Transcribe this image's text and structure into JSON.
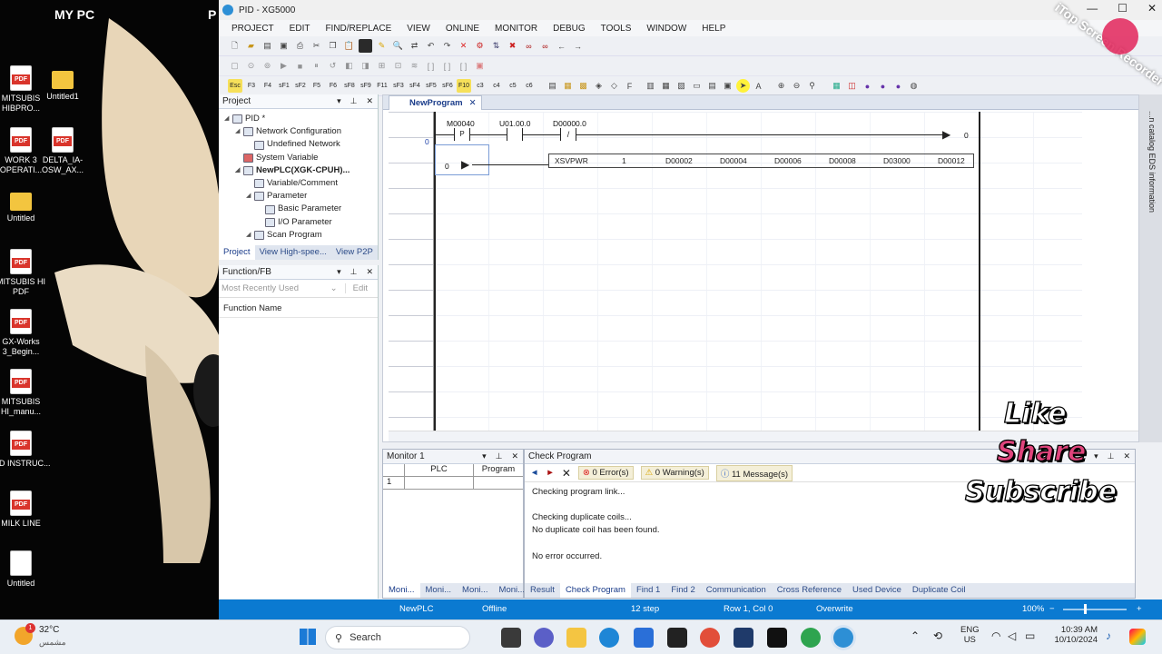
{
  "desktop": {
    "corner_label": "MY PC",
    "corner_label_2": "P",
    "icons": [
      {
        "label": "MITSUBIS HIBPRO...",
        "type": "pdf"
      },
      {
        "label": "Untitled1",
        "type": "folder"
      },
      {
        "label": "WORK 3 OPERATI...",
        "type": "pdf"
      },
      {
        "label": "DELTA_IA-OSW_AX...",
        "type": "pdf"
      },
      {
        "label": "Untitled",
        "type": "folder"
      },
      {
        "label": "MITSUBIS HI PDF",
        "type": "pdf"
      },
      {
        "label": "GX-Works 3_Begin...",
        "type": "pdf"
      },
      {
        "label": "MITSUBIS HI_manu...",
        "type": "pdf"
      },
      {
        "label": "PID INSTRUC...",
        "type": "pdf"
      },
      {
        "label": "MILK LINE",
        "type": "pdf"
      },
      {
        "label": "Untitled",
        "type": "doc"
      }
    ]
  },
  "window": {
    "title": "PID - XG5000",
    "controls": [
      "—",
      "☐",
      "✕"
    ]
  },
  "menu": [
    "PROJECT",
    "EDIT",
    "FIND/REPLACE",
    "VIEW",
    "ONLINE",
    "MONITOR",
    "DEBUG",
    "TOOLS",
    "WINDOW",
    "HELP"
  ],
  "function_keys": [
    "Esc",
    "F3",
    "F4",
    "sF1",
    "sF2",
    "F5",
    "F6",
    "sF8",
    "sF9",
    "F11",
    "sF3",
    "sF4",
    "sF5",
    "sF6",
    "F10",
    "c3",
    "c4",
    "c5",
    "c6"
  ],
  "project_panel": {
    "title": "Project",
    "tree": [
      {
        "label": "PID *",
        "level": 0,
        "bold": false
      },
      {
        "label": "Network Configuration",
        "level": 1,
        "bold": false
      },
      {
        "label": "Undefined Network",
        "level": 2,
        "bold": false
      },
      {
        "label": "System Variable",
        "level": 1,
        "bold": false
      },
      {
        "label": "NewPLC(XGK-CPUH)...",
        "level": 1,
        "bold": true
      },
      {
        "label": "Variable/Comment",
        "level": 2,
        "bold": false
      },
      {
        "label": "Parameter",
        "level": 2,
        "bold": false
      },
      {
        "label": "Basic Parameter",
        "level": 3,
        "bold": false
      },
      {
        "label": "I/O Parameter",
        "level": 3,
        "bold": false
      },
      {
        "label": "Scan Program",
        "level": 2,
        "bold": false
      }
    ],
    "tabs": [
      "Project",
      "View High-spee...",
      "View P2P"
    ]
  },
  "function_panel": {
    "title": "Function/FB",
    "dropdown": "Most Recently Used",
    "edit_button": "Edit",
    "column": "Function Name"
  },
  "editor": {
    "tab": "NewProgram",
    "rung0": {
      "step": "0",
      "contacts": [
        "M00040",
        "U01.00.0",
        "D00000.0"
      ],
      "contact_types": [
        "P",
        "",
        "/"
      ],
      "end_number": "0"
    },
    "rung1": {
      "step": "0",
      "instruction": [
        "XSVPWR",
        "1",
        "D00002",
        "D00004",
        "D00006",
        "D00008",
        "D03000",
        "D00012"
      ]
    },
    "side_vertical_text": "...n catalog  EDS information"
  },
  "monitor_panel": {
    "title": "Monitor 1",
    "columns": [
      "PLC",
      "Program"
    ],
    "row": "1",
    "tabs": [
      "Moni...",
      "Moni...",
      "Moni...",
      "Moni..."
    ]
  },
  "check_panel": {
    "title": "Check Program",
    "errors": "0 Error(s)",
    "warnings": "0 Warning(s)",
    "messages_count": "11 Message(s)",
    "lines": [
      "Checking program link...",
      "",
      "Checking duplicate coils...",
      "No duplicate coil has been found.",
      "",
      "No error occurred."
    ],
    "tabs": [
      "Result",
      "Check Program",
      "Find 1",
      "Find 2",
      "Communication",
      "Cross Reference",
      "Used Device",
      "Duplicate Coil"
    ]
  },
  "status": {
    "plc": "NewPLC",
    "mode": "Offline",
    "step": "12 step",
    "pos": "Row 1, Col 0",
    "insert": "Overwrite",
    "zoom": "100%"
  },
  "overlay": {
    "like": "Like",
    "share": "Share",
    "subscribe": "Subscribe",
    "watermark": "iTop Screen Recorder"
  },
  "taskbar": {
    "weather_temp": "32°C",
    "weather_desc": "مشمس",
    "search": "Search",
    "lang1": "ENG",
    "lang2": "US",
    "time": "10:39 AM",
    "date": "10/10/2024"
  },
  "colors": {
    "accent": "#0b7ad1",
    "share_pink": "#e0447c"
  }
}
